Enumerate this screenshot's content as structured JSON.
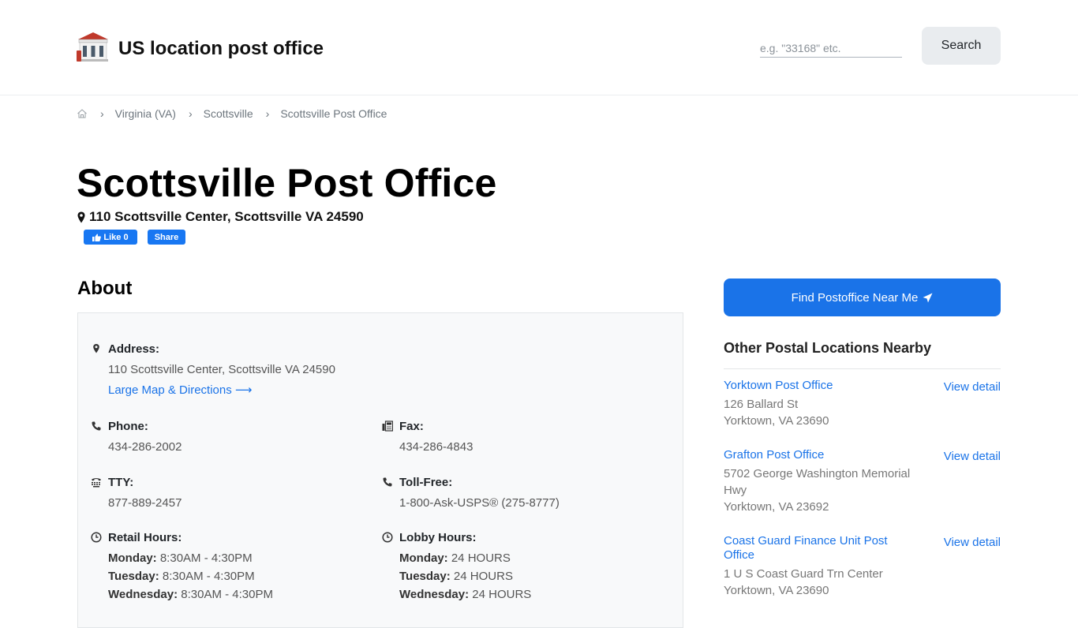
{
  "header": {
    "site_title": "US location post office",
    "search_placeholder": "e.g. \"33168\" etc.",
    "search_label": "Search"
  },
  "breadcrumb": {
    "items": [
      "Virginia (VA)",
      "Scottsville",
      "Scottsville Post Office"
    ]
  },
  "page": {
    "title": "Scottsville Post Office",
    "address": "110 Scottsville Center, Scottsville VA 24590",
    "fb_like_label": "Like 0",
    "fb_share_label": "Share"
  },
  "about": {
    "heading": "About",
    "address_label": "Address:",
    "address_value": "110 Scottsville Center, Scottsville VA 24590",
    "map_link": "Large Map & Directions ⟶",
    "phone_label": "Phone:",
    "phone_value": "434-286-2002",
    "fax_label": "Fax:",
    "fax_value": "434-286-4843",
    "tty_label": "TTY:",
    "tty_value": "877-889-2457",
    "tollfree_label": "Toll-Free:",
    "tollfree_value": "1-800-Ask-USPS® (275-8777)",
    "retail_label": "Retail Hours:",
    "retail_hours": [
      {
        "day": "Monday:",
        "time": "8:30AM - 4:30PM"
      },
      {
        "day": "Tuesday:",
        "time": "8:30AM - 4:30PM"
      },
      {
        "day": "Wednesday:",
        "time": "8:30AM - 4:30PM"
      }
    ],
    "lobby_label": "Lobby Hours:",
    "lobby_hours": [
      {
        "day": "Monday:",
        "time": "24 HOURS"
      },
      {
        "day": "Tuesday:",
        "time": "24 HOURS"
      },
      {
        "day": "Wednesday:",
        "time": "24 HOURS"
      }
    ]
  },
  "sidebar": {
    "find_button": "Find Postoffice Near Me",
    "nearby_heading": "Other Postal Locations Nearby",
    "view_label": "View detail",
    "locations": [
      {
        "name": "Yorktown Post Office",
        "street": "126 Ballard St",
        "city": "Yorktown, VA 23690"
      },
      {
        "name": "Grafton Post Office",
        "street": "5702 George Washington Memorial Hwy",
        "city": "Yorktown, VA 23692"
      },
      {
        "name": "Coast Guard Finance Unit Post Office",
        "street": "1 U S Coast Guard Trn Center",
        "city": "Yorktown, VA 23690"
      }
    ]
  },
  "colors": {
    "accent": "#1a73e8",
    "facebook": "#1877f2",
    "search_button_bg": "#e9ecef",
    "about_box_bg": "#f8f9fa"
  },
  "icons": [
    "post-office-logo-icon",
    "home-icon",
    "chevron-right-icon",
    "map-pin-icon",
    "thumbs-up-icon",
    "phone-icon",
    "fax-icon",
    "tty-icon",
    "clock-icon",
    "paper-plane-icon"
  ]
}
